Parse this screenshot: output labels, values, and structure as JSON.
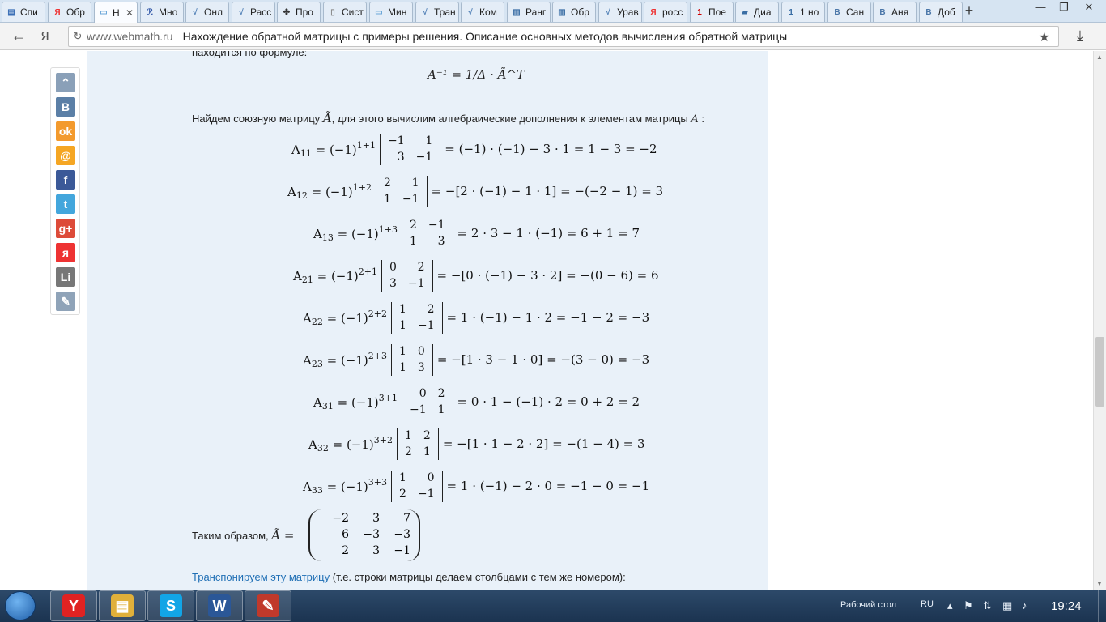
{
  "tabs": [
    {
      "label": "Спи",
      "icon": "document-icon",
      "glyph": "▤",
      "color": "#3b6fb6",
      "active": false,
      "close": ""
    },
    {
      "label": "Обр",
      "icon": "yandex-icon",
      "glyph": "Я",
      "color": "#e33",
      "active": false,
      "close": ""
    },
    {
      "label": "Н",
      "icon": "page-icon",
      "glyph": "▭",
      "color": "#6aa6d8",
      "active": true,
      "close": "✕"
    },
    {
      "label": "Мно",
      "icon": "formula-icon",
      "glyph": "ℛ",
      "color": "#3358a8",
      "active": false,
      "close": ""
    },
    {
      "label": "Онл",
      "icon": "webmath-icon",
      "glyph": "√",
      "color": "#4a7bb3",
      "active": false,
      "close": ""
    },
    {
      "label": "Расс",
      "icon": "webmath-icon",
      "glyph": "√",
      "color": "#4a7bb3",
      "active": false,
      "close": ""
    },
    {
      "label": "Про",
      "icon": "clover-icon",
      "glyph": "✤",
      "color": "#333",
      "active": false,
      "close": ""
    },
    {
      "label": "Сист",
      "icon": "page-icon",
      "glyph": "▯",
      "color": "#888",
      "active": false,
      "close": ""
    },
    {
      "label": "Мин",
      "icon": "page-icon",
      "glyph": "▭",
      "color": "#6aa6d8",
      "active": false,
      "close": ""
    },
    {
      "label": "Тран",
      "icon": "webmath-icon",
      "glyph": "√",
      "color": "#4a7bb3",
      "active": false,
      "close": ""
    },
    {
      "label": "Ком",
      "icon": "webmath-icon",
      "glyph": "√",
      "color": "#4a7bb3",
      "active": false,
      "close": ""
    },
    {
      "label": "Ранг",
      "icon": "book-icon",
      "glyph": "▥",
      "color": "#3a6ea5",
      "active": false,
      "close": ""
    },
    {
      "label": "Обр",
      "icon": "book-icon",
      "glyph": "▥",
      "color": "#3a6ea5",
      "active": false,
      "close": ""
    },
    {
      "label": "Урав",
      "icon": "webmath-icon",
      "glyph": "√",
      "color": "#4a7bb3",
      "active": false,
      "close": ""
    },
    {
      "label": "росс",
      "icon": "yandex-icon",
      "glyph": "Я",
      "color": "#e33",
      "active": false,
      "close": ""
    },
    {
      "label": "Пое",
      "icon": "channel-one-icon",
      "glyph": "1",
      "color": "#c00",
      "active": false,
      "close": ""
    },
    {
      "label": "Диа",
      "icon": "chat-icon",
      "glyph": "▰",
      "color": "#3a6ea5",
      "active": false,
      "close": ""
    },
    {
      "label": "1 но",
      "icon": "one-icon",
      "glyph": "1",
      "color": "#3a6ea5",
      "active": false,
      "close": ""
    },
    {
      "label": "Сан",
      "icon": "vk-icon",
      "glyph": "В",
      "color": "#4a76a8",
      "active": false,
      "close": ""
    },
    {
      "label": "Аня",
      "icon": "vk-icon",
      "glyph": "В",
      "color": "#4a76a8",
      "active": false,
      "close": ""
    },
    {
      "label": "Доб",
      "icon": "vk-icon",
      "glyph": "В",
      "color": "#4a76a8",
      "active": false,
      "close": ""
    }
  ],
  "new_tab": "+",
  "window": {
    "minimize": "—",
    "maximize": "❐",
    "close": "✕"
  },
  "toolbar": {
    "back": "←",
    "logo": "Я",
    "lock": "↻",
    "domain": "www.webmath.ru",
    "title": "Нахождение обратной матрицы с примеры решения. Описание основных методов вычисления обратной матрицы",
    "star": "★",
    "download": "⤓"
  },
  "social": [
    {
      "icon": "scroll-up-icon",
      "glyph": "⌃",
      "color": "#8aa0b8"
    },
    {
      "icon": "vkontakte-icon",
      "glyph": "B",
      "color": "#5b7fa6"
    },
    {
      "icon": "odnoklassniki-icon",
      "glyph": "ok",
      "color": "#f39a2d"
    },
    {
      "icon": "mailru-icon",
      "glyph": "@",
      "color": "#f5a623"
    },
    {
      "icon": "facebook-icon",
      "glyph": "f",
      "color": "#3b5998"
    },
    {
      "icon": "twitter-icon",
      "glyph": "t",
      "color": "#43a6dc"
    },
    {
      "icon": "google-plus-icon",
      "glyph": "g+",
      "color": "#dd4b39"
    },
    {
      "icon": "moimir-icon",
      "glyph": "я",
      "color": "#e33"
    },
    {
      "icon": "liveinternet-icon",
      "glyph": "Li",
      "color": "#777"
    },
    {
      "icon": "livejournal-icon",
      "glyph": "✎",
      "color": "#8fa3b8"
    }
  ],
  "page": {
    "formula_intro": "находится по формуле:",
    "inverse_formula": "A⁻¹ = 1/Δ · Ã^T",
    "sentence_1": "Найдем союзную матрицу",
    "sentence_1_sym": "Ã",
    "sentence_2": ", для этого вычислим алгебраические дополнения к элементам матрицы",
    "sentence_2_sym": "A",
    "sentence_2_end": ":",
    "final_label": "Таким образом,",
    "final_sym": "Ã =",
    "transpose_link": "Транспонируем эту матрицу",
    "transpose_rest": " (т.е. строки матрицы делаем столбцами с тем же номером):"
  },
  "cofactors": [
    {
      "name": "A11",
      "sub": "11",
      "pow": "1+1",
      "minor": [
        "−1",
        "1",
        "3",
        "−1"
      ],
      "result": "= (−1) · (−1) − 3 · 1 = 1 − 3 = −2"
    },
    {
      "name": "A12",
      "sub": "12",
      "pow": "1+2",
      "minor": [
        "2",
        "1",
        "1",
        "−1"
      ],
      "result": "= −[2 · (−1) − 1 · 1] = −(−2 − 1) = 3"
    },
    {
      "name": "A13",
      "sub": "13",
      "pow": "1+3",
      "minor": [
        "2",
        "−1",
        "1",
        "3"
      ],
      "result": "= 2 · 3 − 1 · (−1) = 6 + 1 = 7"
    },
    {
      "name": "A21",
      "sub": "21",
      "pow": "2+1",
      "minor": [
        "0",
        "2",
        "3",
        "−1"
      ],
      "result": "= −[0 · (−1) − 3 · 2] = −(0 − 6) = 6"
    },
    {
      "name": "A22",
      "sub": "22",
      "pow": "2+2",
      "minor": [
        "1",
        "2",
        "1",
        "−1"
      ],
      "result": "= 1 · (−1) − 1 · 2 = −1 − 2 = −3"
    },
    {
      "name": "A23",
      "sub": "23",
      "pow": "2+3",
      "minor": [
        "1",
        "0",
        "1",
        "3"
      ],
      "result": "= −[1 · 3 − 1 · 0] = −(3 − 0) = −3"
    },
    {
      "name": "A31",
      "sub": "31",
      "pow": "3+1",
      "minor": [
        "0",
        "2",
        "−1",
        "1"
      ],
      "result": "= 0 · 1 − (−1) · 2 = 0 + 2 = 2"
    },
    {
      "name": "A32",
      "sub": "32",
      "pow": "3+2",
      "minor": [
        "1",
        "2",
        "2",
        "1"
      ],
      "result": "= −[1 · 1 − 2 · 2] = −(1 − 4) = 3"
    },
    {
      "name": "A33",
      "sub": "33",
      "pow": "3+3",
      "minor": [
        "1",
        "0",
        "2",
        "−1"
      ],
      "result": "= 1 · (−1) − 2 · 0 = −1 − 0 = −1"
    }
  ],
  "adjugate": [
    "−2",
    "3",
    "7",
    "6",
    "−3",
    "−3",
    "2",
    "3",
    "−1"
  ],
  "taskbar": {
    "apps": [
      {
        "icon": "yandex-browser-icon",
        "glyph": "Y",
        "color": "#e02222"
      },
      {
        "icon": "explorer-icon",
        "glyph": "▤",
        "color": "#e0b03a"
      },
      {
        "icon": "skype-icon",
        "glyph": "S",
        "color": "#12a5e6"
      },
      {
        "icon": "word-icon",
        "glyph": "W",
        "color": "#2b5797"
      },
      {
        "icon": "paint-icon",
        "glyph": "✎",
        "color": "#c0392b"
      }
    ],
    "desktop": "Рабочий стол",
    "lang": "RU",
    "tray": [
      {
        "icon": "chevron-up-icon",
        "glyph": "▴"
      },
      {
        "icon": "flag-icon",
        "glyph": "⚑"
      },
      {
        "icon": "sync-icon",
        "glyph": "⇅"
      },
      {
        "icon": "network-icon",
        "glyph": "▦"
      },
      {
        "icon": "volume-icon",
        "glyph": "♪"
      }
    ],
    "clock": "19:24"
  }
}
